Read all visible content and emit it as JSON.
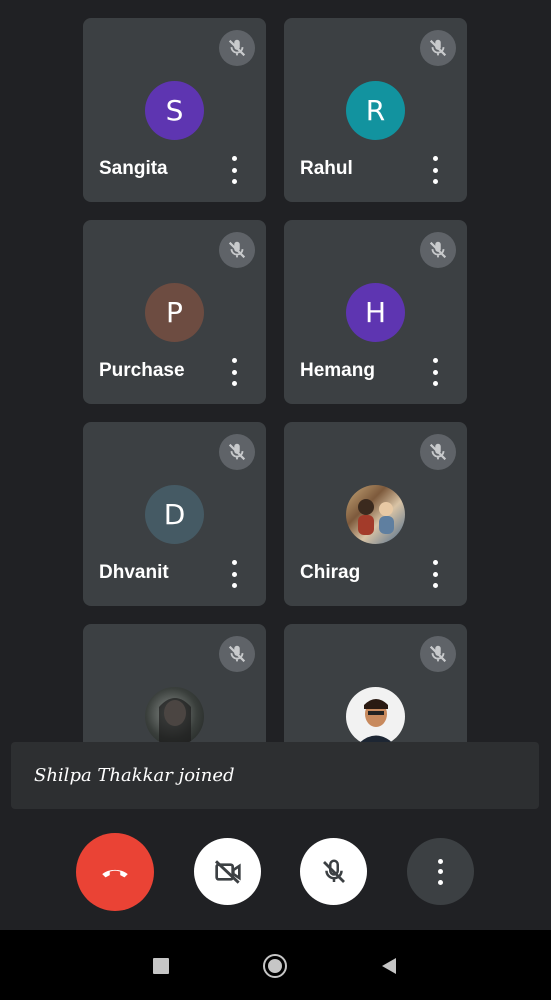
{
  "participants": [
    {
      "name": "Sangita",
      "initial": "S",
      "color": "#5e35b1"
    },
    {
      "name": "Rahul",
      "initial": "R",
      "color": "#12939f"
    },
    {
      "name": "Purchase",
      "initial": "P",
      "color": "#6d4c41"
    },
    {
      "name": "Hemang",
      "initial": "H",
      "color": "#5e35b1"
    },
    {
      "name": "Dhvanit",
      "initial": "D",
      "color": "#455a64"
    },
    {
      "name": "Chirag",
      "photo": "profile-photo"
    },
    {
      "name": "",
      "photo": "profile-photo"
    },
    {
      "name": "",
      "photo": "profile-photo"
    }
  ],
  "toast": {
    "text": "Shilpa Thakkar joined"
  },
  "controls": {
    "end_call": "end-call-icon",
    "camera": "camera-off-icon",
    "microphone": "mic-off-icon",
    "more": "more-vert-icon",
    "end_color": "#ea4335"
  },
  "navbar": {
    "recents": "square-icon",
    "home": "circle-icon",
    "back": "triangle-icon"
  }
}
